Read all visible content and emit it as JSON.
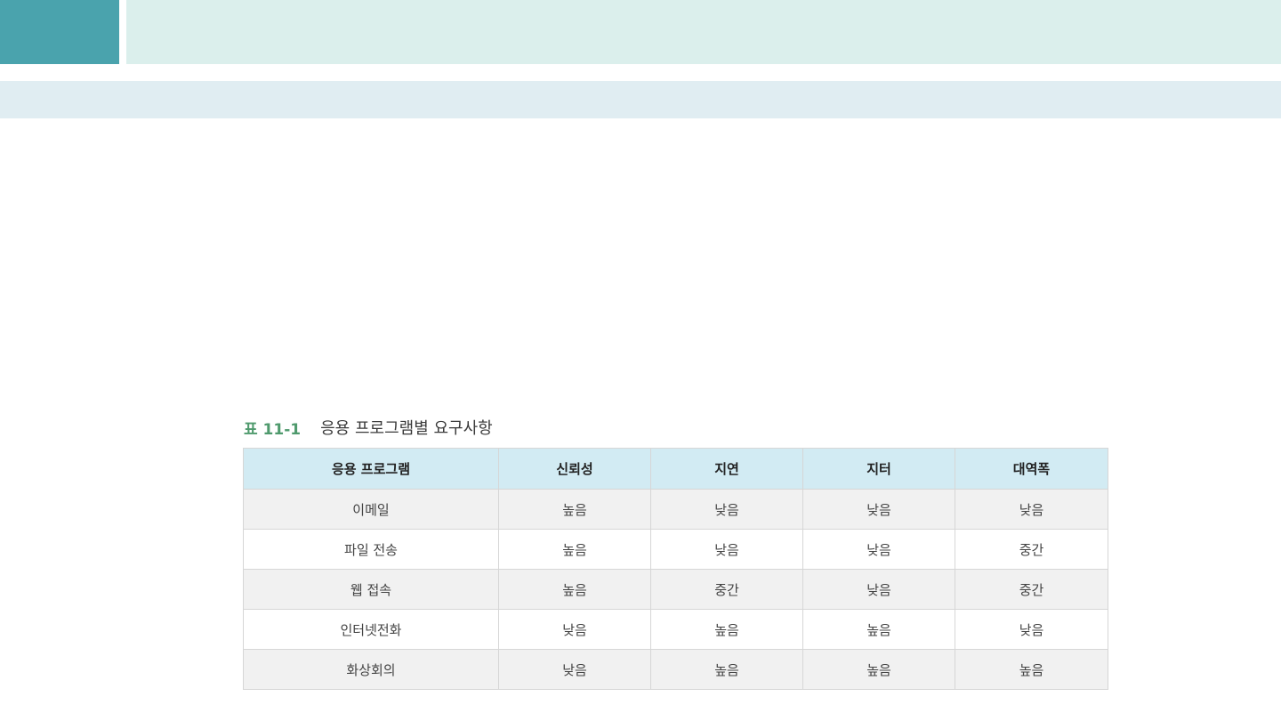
{
  "caption": {
    "number": "표 11-1",
    "title": "응용 프로그램별 요구사항"
  },
  "table": {
    "headers": [
      "응용 프로그램",
      "신뢰성",
      "지연",
      "지터",
      "대역폭"
    ],
    "rows": [
      [
        "이메일",
        "높음",
        "낮음",
        "낮음",
        "낮음"
      ],
      [
        "파일 전송",
        "높음",
        "낮음",
        "낮음",
        "중간"
      ],
      [
        "웹 접속",
        "높음",
        "중간",
        "낮음",
        "중간"
      ],
      [
        "인터넷전화",
        "낮음",
        "높음",
        "높음",
        "낮음"
      ],
      [
        "화상회의",
        "낮음",
        "높음",
        "높음",
        "높음"
      ]
    ]
  },
  "colors": {
    "header_accent": "#4aa3ad",
    "header_bar": "#dbefec",
    "subheader_bar": "#e0edf2",
    "table_header": "#d2ebf3",
    "caption_number": "#4f9a6d"
  }
}
